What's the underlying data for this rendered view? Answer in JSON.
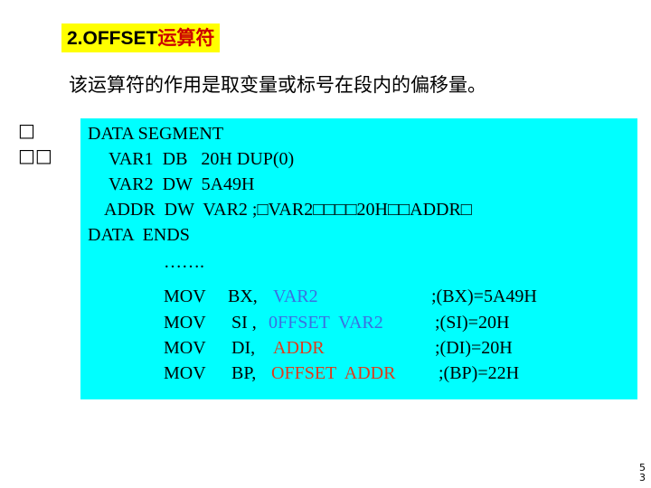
{
  "title": {
    "prefix": "2.OFFSET",
    "cn": "运算符"
  },
  "intro": "该运算符的作用是取变量或标号在段内的偏移量。",
  "side_glyphs": [
    "□",
    "□□"
  ],
  "code": {
    "l1": "DATA SEGMENT",
    "l2": "VAR1  DB   20H DUP(0)",
    "l3": "VAR2  DW  5A49H",
    "l4": "ADDR  DW  VAR2 ;□VAR2□□□□20H□□ADDR□",
    "l5": "DATA  ENDS",
    "dots": "…….",
    "mov1": {
      "op": "MOV",
      "arg": "BX,",
      "hl": "VAR2",
      "comment": ";(BX)=5A49H"
    },
    "mov2": {
      "op": "MOV",
      "arg": "SI ,",
      "hl": "0FFSET  VAR2",
      "comment": ";(SI)=20H"
    },
    "mov3": {
      "op": "MOV",
      "arg": "DI,",
      "hl": "ADDR",
      "comment": ";(DI)=20H"
    },
    "mov4": {
      "op": "MOV",
      "arg": "BP,",
      "hl": "OFFSET  ADDR",
      "comment": ";(BP)=22H"
    }
  },
  "page_number": [
    "5",
    "3"
  ],
  "colors": {
    "title_bg": "#ffff00",
    "code_bg": "#00ffff",
    "blue": "#3b6fe0",
    "red": "#e03a1a"
  }
}
